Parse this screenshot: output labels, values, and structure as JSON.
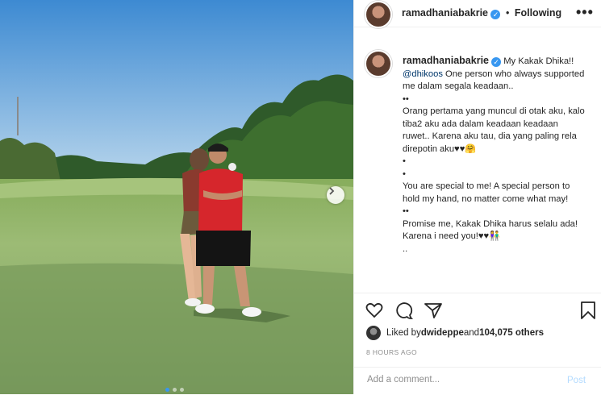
{
  "post": {
    "username": "ramadhaniabakrie",
    "verified_icon": "verified-badge-icon",
    "follow_state": "Following",
    "separator": "•",
    "more_icon": "more-options-icon",
    "more_glyph": "•••"
  },
  "caption": {
    "username": "ramadhaniabakrie",
    "intro": "My Kakak Dhika!! ",
    "mention": "@dhikoos",
    "body": " One person who always supported me dalam segala keadaan..\n••\nOrang pertama yang muncul di otak aku, kalo tiba2 aku ada dalam keadaan keadaan ruwet.. Karena aku tau, dia yang paling rela direpotin aku♥♥🤗\n•\n•\nYou are special to me! A special person to hold my hand, no matter come what may!\n••\nPromise me, Kakak Dhika harus selalu ada! Karena i need you!♥♥👫\n.."
  },
  "actions": {
    "like_icon": "heart-icon",
    "comment_icon": "comment-icon",
    "share_icon": "share-icon",
    "save_icon": "bookmark-icon"
  },
  "likes": {
    "prefix": "Liked by ",
    "user": "dwideppe",
    "middle": " and ",
    "count": "104,075 others"
  },
  "timestamp": "8 HOURS AGO",
  "comment_box": {
    "placeholder": "Add a comment...",
    "post_label": "Post"
  },
  "carousel": {
    "total": 3,
    "active": 0,
    "next_icon": "chevron-right-icon"
  },
  "colors": {
    "link": "#00376b",
    "verified": "#3897f0",
    "post_disabled": "#b3dbff",
    "meta": "#8e8e8e"
  }
}
